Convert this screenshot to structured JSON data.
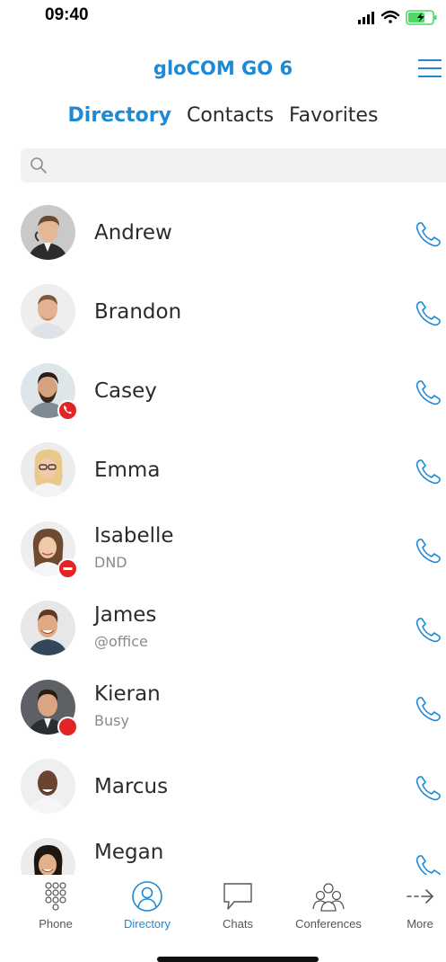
{
  "status_bar": {
    "time": "09:40"
  },
  "header": {
    "title": "gloCOM GO 6"
  },
  "tabs": [
    {
      "label": "Directory",
      "active": true
    },
    {
      "label": "Contacts",
      "active": false
    },
    {
      "label": "Favorites",
      "active": false
    }
  ],
  "search": {
    "placeholder": ""
  },
  "contacts": [
    {
      "name": "Andrew",
      "sub": "",
      "badge": ""
    },
    {
      "name": "Brandon",
      "sub": "",
      "badge": ""
    },
    {
      "name": "Casey",
      "sub": "",
      "badge": "on-call"
    },
    {
      "name": "Emma",
      "sub": "",
      "badge": ""
    },
    {
      "name": "Isabelle",
      "sub": "DND",
      "badge": "dnd"
    },
    {
      "name": "James",
      "sub": "@office",
      "badge": ""
    },
    {
      "name": "Kieran",
      "sub": "Busy",
      "badge": "busy"
    },
    {
      "name": "Marcus",
      "sub": "",
      "badge": ""
    },
    {
      "name": "Megan",
      "sub": "",
      "badge": ""
    }
  ],
  "tabbar": [
    {
      "label": "Phone",
      "icon": "dialpad-icon",
      "active": false
    },
    {
      "label": "Directory",
      "icon": "person-circle-icon",
      "active": true
    },
    {
      "label": "Chats",
      "icon": "chat-bubble-icon",
      "active": false
    },
    {
      "label": "Conferences",
      "icon": "group-icon",
      "active": false
    },
    {
      "label": "More",
      "icon": "arrow-right-icon",
      "active": false
    }
  ],
  "colors": {
    "accent": "#1e8ad3",
    "status_red": "#e22426",
    "text": "#2b2b2b",
    "muted": "#8a8a8a"
  }
}
